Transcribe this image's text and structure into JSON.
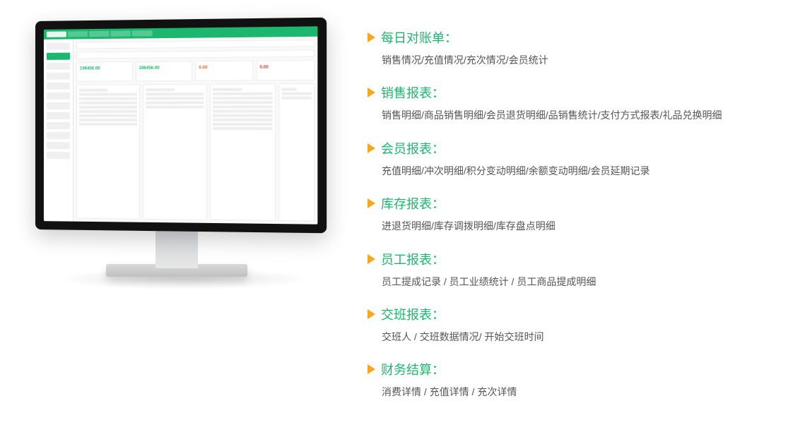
{
  "monitor": {
    "cards": [
      {
        "value": "106456.00"
      },
      {
        "value": "106456.00"
      },
      {
        "value": "0.00"
      },
      {
        "value": "0.00"
      }
    ]
  },
  "features": [
    {
      "title": "每日对账单：",
      "desc": "销售情况/充值情况/充次情况/会员统计"
    },
    {
      "title": "销售报表：",
      "desc": "销售明细/商品销售明细/会员退货明细/品销售统计/支付方式报表/礼品兑换明细"
    },
    {
      "title": "会员报表：",
      "desc": "充值明细/冲次明细/积分变动明细/余额变动明细/会员延期记录"
    },
    {
      "title": "库存报表：",
      "desc": "进退货明细/库存调拨明细/库存盘点明细"
    },
    {
      "title": "员工报表：",
      "desc": "员工提成记录 / 员工业绩统计 / 员工商品提成明细"
    },
    {
      "title": "交班报表：",
      "desc": "交班人 / 交班数据情况/ 开始交班时间"
    },
    {
      "title": "财务结算：",
      "desc": "消费详情 / 充值详情 / 充次详情"
    }
  ]
}
